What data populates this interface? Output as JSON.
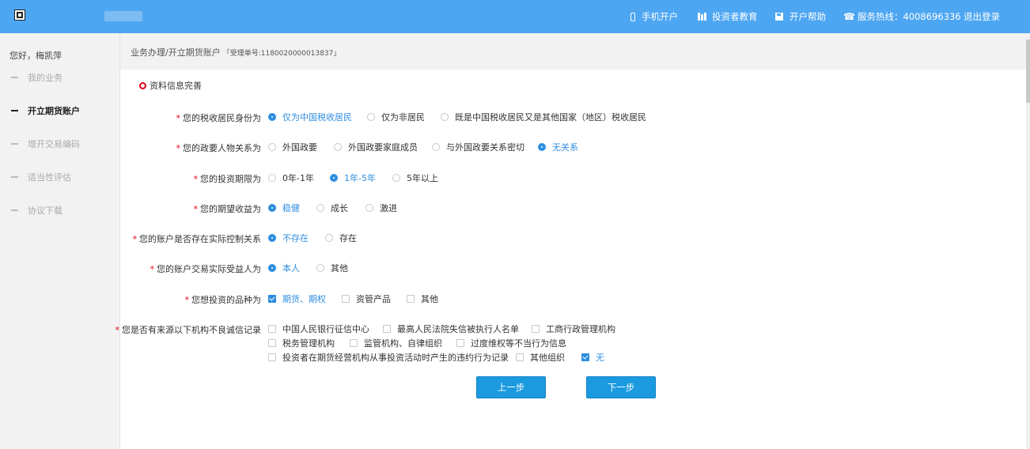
{
  "header": {
    "nav": {
      "mobile": "手机开户",
      "education": "投资者教育",
      "help": "开户帮助",
      "hotline": "服务热线：4008696336",
      "logout": "退出登录"
    }
  },
  "sidebar": {
    "greeting": "您好，梅凯萍",
    "items": [
      {
        "label": "我的业务"
      },
      {
        "label": "开立期货账户"
      },
      {
        "label": "增开交易编码"
      },
      {
        "label": "适当性评估"
      },
      {
        "label": "协议下载"
      }
    ]
  },
  "breadcrumb": {
    "path": "业务办理/开立期货账户",
    "ticket": "「受理单号:1180020000013837」"
  },
  "section": {
    "title": "资料信息完善"
  },
  "form": {
    "required_mark": "*",
    "tax_resident": {
      "label": "您的税收居民身份为",
      "options": [
        "仅为中国税收居民",
        "仅为非居民",
        "既是中国税收居民又是其他国家（地区）税收居民"
      ],
      "selected": "仅为中国税收居民"
    },
    "political": {
      "label": "您的政要人物关系为",
      "options": [
        "外国政要",
        "外国政要家庭成员",
        "与外国政要关系密切",
        "无关系"
      ],
      "selected": "无关系"
    },
    "term": {
      "label": "您的投资期限为",
      "options": [
        "0年-1年",
        "1年-5年",
        "5年以上"
      ],
      "selected": "1年-5年"
    },
    "return": {
      "label": "您的期望收益为",
      "options": [
        "稳健",
        "成长",
        "激进"
      ],
      "selected": "稳健"
    },
    "controller": {
      "label": "您的账户是否存在实际控制关系",
      "options": [
        "不存在",
        "存在"
      ],
      "selected": "不存在"
    },
    "beneficiary": {
      "label": "您的账户交易实际受益人为",
      "options": [
        "本人",
        "其他"
      ],
      "selected": "本人"
    },
    "products": {
      "label": "您想投资的品种为",
      "options": [
        "期货、期权",
        "资管产品",
        "其他"
      ],
      "checked": [
        "期货、期权"
      ]
    },
    "records": {
      "label": "您是否有来源以下机构不良诚信记录",
      "row1": [
        "中国人民银行征信中心",
        "最高人民法院失信被执行人名单",
        "工商行政管理机构"
      ],
      "row2": [
        "税务管理机构",
        "监管机构、自律组织",
        "过度维权等不当行为信息"
      ],
      "row3": [
        "投资者在期货经营机构从事投资活动时产生的违约行为记录",
        "其他组织",
        "无"
      ],
      "checked": [
        "无"
      ]
    }
  },
  "buttons": {
    "prev": "上一步",
    "next": "下一步"
  },
  "colors": {
    "header": "#4da6f2",
    "accent": "#2e8ee0",
    "button": "#1b9ae0",
    "required": "#e60012"
  }
}
